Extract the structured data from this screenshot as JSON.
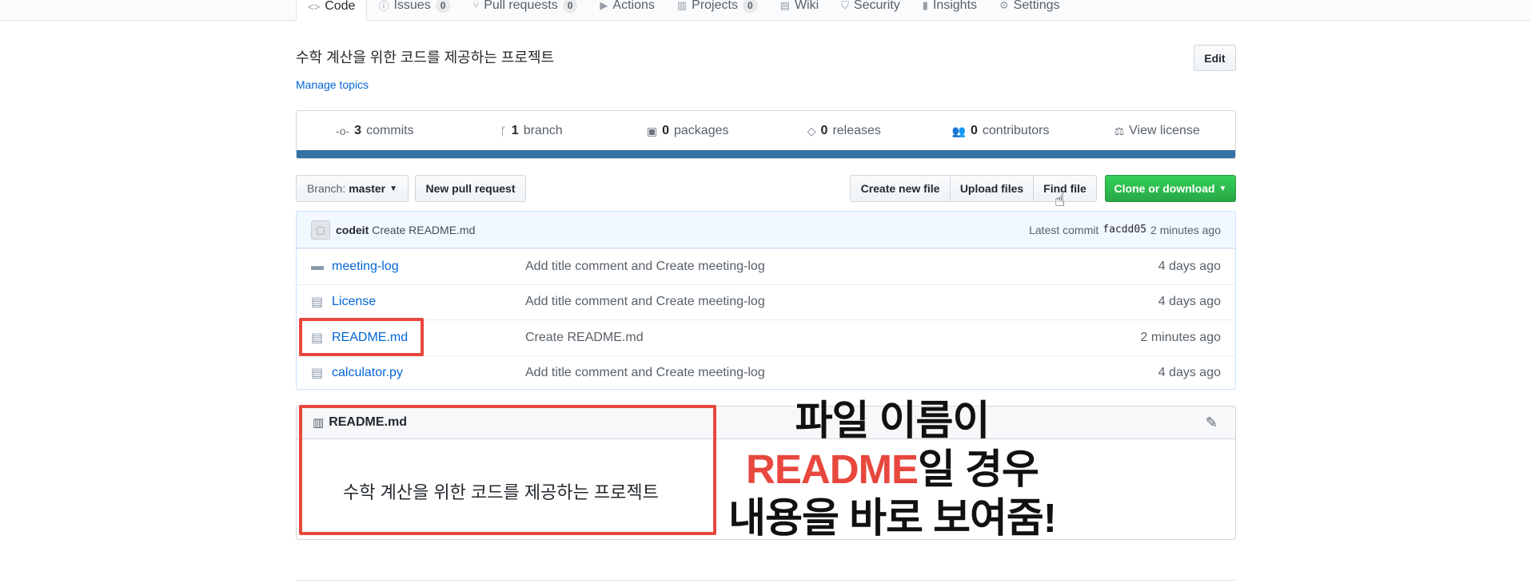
{
  "repo_nav": {
    "tabs": [
      {
        "label": "Code",
        "icon": "code-icon",
        "counter": null
      },
      {
        "label": "Issues",
        "icon": "issue-icon",
        "counter": "0"
      },
      {
        "label": "Pull requests",
        "icon": "pull-request-icon",
        "counter": "0"
      },
      {
        "label": "Actions",
        "icon": "play-icon",
        "counter": null
      },
      {
        "label": "Projects",
        "icon": "project-icon",
        "counter": "0"
      },
      {
        "label": "Wiki",
        "icon": "book-icon",
        "counter": null
      },
      {
        "label": "Security",
        "icon": "shield-icon",
        "counter": null
      },
      {
        "label": "Insights",
        "icon": "graph-icon",
        "counter": null
      },
      {
        "label": "Settings",
        "icon": "gear-icon",
        "counter": null
      }
    ]
  },
  "description": "수학 계산을 위한 코드를 제공하는 프로젝트",
  "manage_topics": "Manage topics",
  "edit_label": "Edit",
  "summary": {
    "commits": {
      "count": "3",
      "label": "commits"
    },
    "branch": {
      "count": "1",
      "label": "branch"
    },
    "packages": {
      "count": "0",
      "label": "packages"
    },
    "releases": {
      "count": "0",
      "label": "releases"
    },
    "contributors": {
      "count": "0",
      "label": "contributors"
    },
    "license": "View license",
    "language_color": "#3572A5"
  },
  "file_nav": {
    "branch_label": "Branch:",
    "branch_value": "master",
    "new_pull_request": "New pull request",
    "create_new_file": "Create new file",
    "upload_files": "Upload files",
    "find_file": "Find file",
    "clone": "Clone or download"
  },
  "commit": {
    "author": "codeit",
    "message": "Create README.md",
    "latest_label": "Latest commit",
    "sha": "facdd05",
    "age": "2 minutes ago"
  },
  "files": [
    {
      "type": "folder",
      "name": "meeting-log",
      "message": "Add title comment and Create meeting-log",
      "age": "4 days ago"
    },
    {
      "type": "file",
      "name": "License",
      "message": "Add title comment and Create meeting-log",
      "age": "4 days ago"
    },
    {
      "type": "file",
      "name": "README.md",
      "message": "Create README.md",
      "age": "2 minutes ago"
    },
    {
      "type": "file",
      "name": "calculator.py",
      "message": "Add title comment and Create meeting-log",
      "age": "4 days ago"
    }
  ],
  "readme": {
    "title": "README.md",
    "body": "수학 계산을 위한 코드를 제공하는 프로젝트"
  },
  "annotation": {
    "line1": "파일 이름이",
    "line2_highlight": "README",
    "line2_rest": "일 경우",
    "line3": "내용을 바로 보여줌!",
    "highlight_color": "#e8473d"
  }
}
